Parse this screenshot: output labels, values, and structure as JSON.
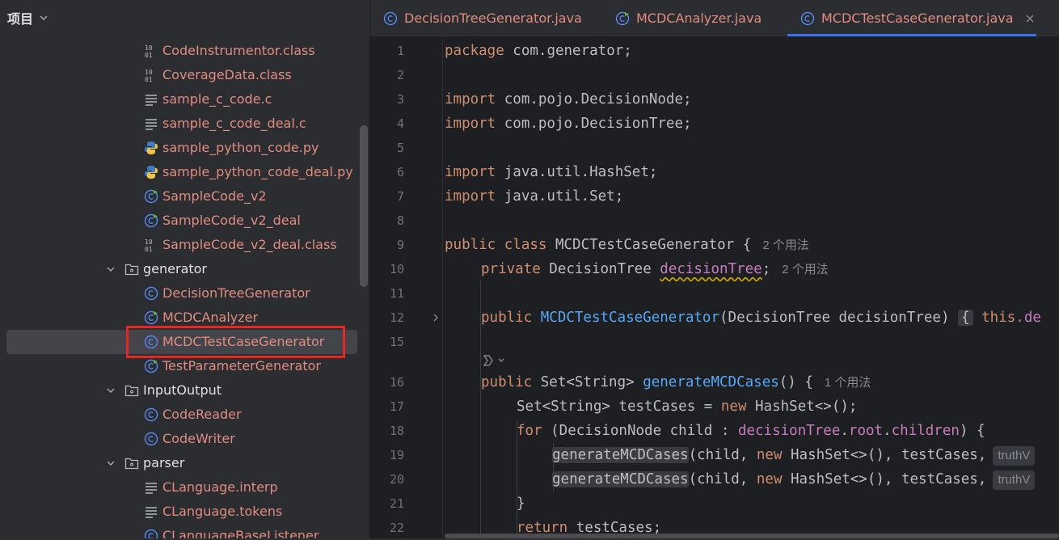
{
  "sidebar": {
    "title": "项目",
    "rows": [
      {
        "label": "CodeInstrumentor.class",
        "icon": "class-file-icon",
        "kind": "file"
      },
      {
        "label": "CoverageData.class",
        "icon": "class-file-icon",
        "kind": "file"
      },
      {
        "label": "sample_c_code.c",
        "icon": "text-file-icon",
        "kind": "file"
      },
      {
        "label": "sample_c_code_deal.c",
        "icon": "text-file-icon",
        "kind": "file"
      },
      {
        "label": "sample_python_code.py",
        "icon": "python-file-icon",
        "kind": "file"
      },
      {
        "label": "sample_python_code_deal.py",
        "icon": "python-file-icon",
        "kind": "file"
      },
      {
        "label": "SampleCode_v2",
        "icon": "java-class-runnable-icon",
        "kind": "file"
      },
      {
        "label": "SampleCode_v2_deal",
        "icon": "java-class-runnable-icon",
        "kind": "file"
      },
      {
        "label": "SampleCode_v2_deal.class",
        "icon": "class-file-icon",
        "kind": "file"
      },
      {
        "label": "generator",
        "icon": "folder-icon",
        "kind": "folder"
      },
      {
        "label": "DecisionTreeGenerator",
        "icon": "java-class-icon",
        "kind": "file"
      },
      {
        "label": "MCDCAnalyzer",
        "icon": "java-class-runnable-icon",
        "kind": "file"
      },
      {
        "label": "MCDCTestCaseGenerator",
        "icon": "java-class-icon",
        "kind": "file",
        "selected": true
      },
      {
        "label": "TestParameterGenerator",
        "icon": "java-class-runnable-icon",
        "kind": "file"
      },
      {
        "label": "InputOutput",
        "icon": "folder-icon",
        "kind": "folder"
      },
      {
        "label": "CodeReader",
        "icon": "java-class-icon",
        "kind": "file"
      },
      {
        "label": "CodeWriter",
        "icon": "java-class-icon",
        "kind": "file"
      },
      {
        "label": "parser",
        "icon": "folder-icon",
        "kind": "folder"
      },
      {
        "label": "CLanguage.interp",
        "icon": "text-file-icon",
        "kind": "file"
      },
      {
        "label": "CLanguage.tokens",
        "icon": "text-file-icon",
        "kind": "file"
      },
      {
        "label": "CLanguageBaseListener",
        "icon": "java-class-icon",
        "kind": "file"
      }
    ]
  },
  "tabs": [
    {
      "label": "DecisionTreeGenerator.java",
      "icon": "java-class-icon"
    },
    {
      "label": "MCDCAnalyzer.java",
      "icon": "java-class-runnable-icon"
    },
    {
      "label": "MCDCTestCaseGenerator.java",
      "icon": "java-class-icon",
      "active": true
    }
  ],
  "editor": {
    "line_numbers": [
      "1",
      "2",
      "3",
      "4",
      "5",
      "6",
      "7",
      "8",
      "9",
      "10",
      "11",
      "12",
      "15",
      "",
      "16",
      "17",
      "18",
      "19",
      "20",
      "21",
      "22"
    ],
    "hints": {
      "class_usages": "2 个用法",
      "field_usages": "2 个用法",
      "method_usages": "1 个用法",
      "param_hint": "truthV"
    },
    "code": {
      "l1": {
        "kw": "package",
        "rest": " com.generator;"
      },
      "l3": {
        "kw": "import",
        "rest": " com.pojo.DecisionNode;"
      },
      "l4": {
        "kw": "import",
        "rest": " com.pojo.DecisionTree;"
      },
      "l6": {
        "kw": "import",
        "rest": " java.util.HashSet;"
      },
      "l7": {
        "kw": "import",
        "rest": " java.util.Set;"
      },
      "l9": {
        "kw": "public class",
        "rest": " MCDCTestCaseGenerator {"
      },
      "l10": {
        "kw": "private",
        "type": " DecisionTree ",
        "field": "decisionTree",
        "end": ";"
      },
      "l12": {
        "kw": "public",
        "fn": " MCDCTestCaseGenerator",
        "params": "(DecisionTree decisionTree)",
        "brace": "{",
        "kw2": " this",
        "tail": ".de"
      },
      "l16": {
        "kw": "public",
        "type": " Set<String> ",
        "fn": "generateMCDCases",
        "end": "() {"
      },
      "l17": {
        "pre": "Set<String> testCases = ",
        "kw": "new",
        "rest": " HashSet<>();"
      },
      "l18": {
        "kw": "for",
        "pre": " (DecisionNode child : ",
        "f1": "decisionTree",
        "dot1": ".",
        "f2": "root",
        "dot2": ".",
        "f3": "children",
        "end": ") {"
      },
      "l19": {
        "call": "generateMCDCases",
        "pre": "(child, ",
        "kw": "new",
        "rest": " HashSet<>(), testCases,"
      },
      "l20": {
        "call": "generateMCDCases",
        "pre": "(child, ",
        "kw": "new",
        "rest": " HashSet<>(), testCases,"
      },
      "l21": {
        "rest": "}"
      },
      "l22": {
        "kw": "return",
        "rest": " testCases;"
      }
    }
  }
}
